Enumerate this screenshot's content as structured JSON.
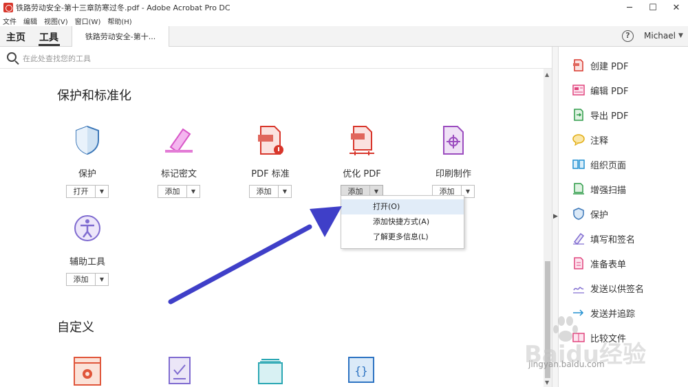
{
  "window": {
    "title": "铁路劳动安全-第十三章防寒过冬.pdf - Adobe Acrobat Pro DC"
  },
  "window_controls": {
    "minimize": "─",
    "maximize": "☐",
    "close": "✕"
  },
  "menu": [
    "文件",
    "编辑",
    "视图(V)",
    "窗口(W)",
    "帮助(H)"
  ],
  "tabs": {
    "home": "主页",
    "tools": "工具",
    "document": "铁路劳动安全-第十..."
  },
  "user": {
    "name": "Michael",
    "help": "?"
  },
  "search": {
    "placeholder": "在此处查找您的工具"
  },
  "sections": {
    "protect": "保护和标准化",
    "custom": "自定义"
  },
  "tools": [
    {
      "label": "保护",
      "button": "打开"
    },
    {
      "label": "标记密文",
      "button": "添加"
    },
    {
      "label": "PDF 标准",
      "button": "添加"
    },
    {
      "label": "优化 PDF",
      "button": "添加"
    },
    {
      "label": "印刷制作",
      "button": "添加"
    },
    {
      "label": "辅助工具",
      "button": "添加"
    }
  ],
  "dropdown": [
    "打开(O)",
    "添加快捷方式(A)",
    "了解更多信息(L)"
  ],
  "right_panel": [
    "创建 PDF",
    "编辑 PDF",
    "导出 PDF",
    "注释",
    "组织页面",
    "增强扫描",
    "保护",
    "填写和签名",
    "准备表单",
    "发送以供签名",
    "发送并追踪",
    "比较文件"
  ],
  "watermark": {
    "logo": "Baidu经验",
    "url": "jingyan.baidu.com"
  },
  "colors": {
    "accent_arrow": "#3f3fc8",
    "pdf_red": "#d8362b",
    "menu_hover": "#e1ecf8"
  }
}
